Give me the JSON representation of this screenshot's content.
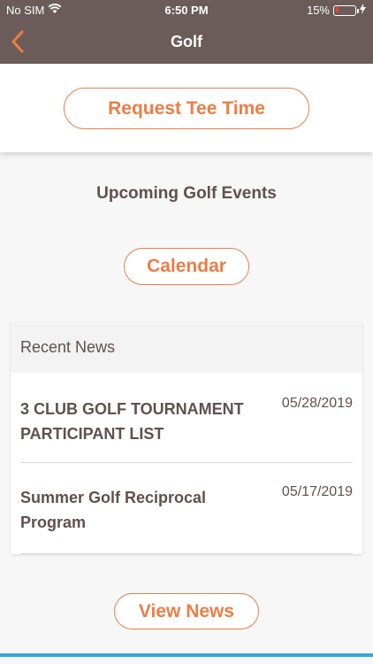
{
  "status_bar": {
    "carrier": "No SIM",
    "time": "6:50 PM",
    "battery_percent": "15%",
    "battery_level": 0.15,
    "battery_color": "#ff3b30"
  },
  "header": {
    "title": "Golf",
    "background": "#6b5c59",
    "back_icon": "chevron-left-icon"
  },
  "actions": {
    "request_tee_time": "Request Tee Time",
    "calendar": "Calendar",
    "view_news": "View News"
  },
  "events": {
    "heading": "Upcoming Golf Events"
  },
  "news": {
    "heading": "Recent News",
    "items": [
      {
        "title": "3 CLUB GOLF TOURNAMENT PARTICIPANT LIST",
        "date": "05/28/2019"
      },
      {
        "title": "Summer Golf Reciprocal Program",
        "date": "05/17/2019"
      }
    ]
  },
  "colors": {
    "accent": "#ed7d45",
    "text": "#5e514f",
    "bottom_bar": "#2fa8dc"
  }
}
